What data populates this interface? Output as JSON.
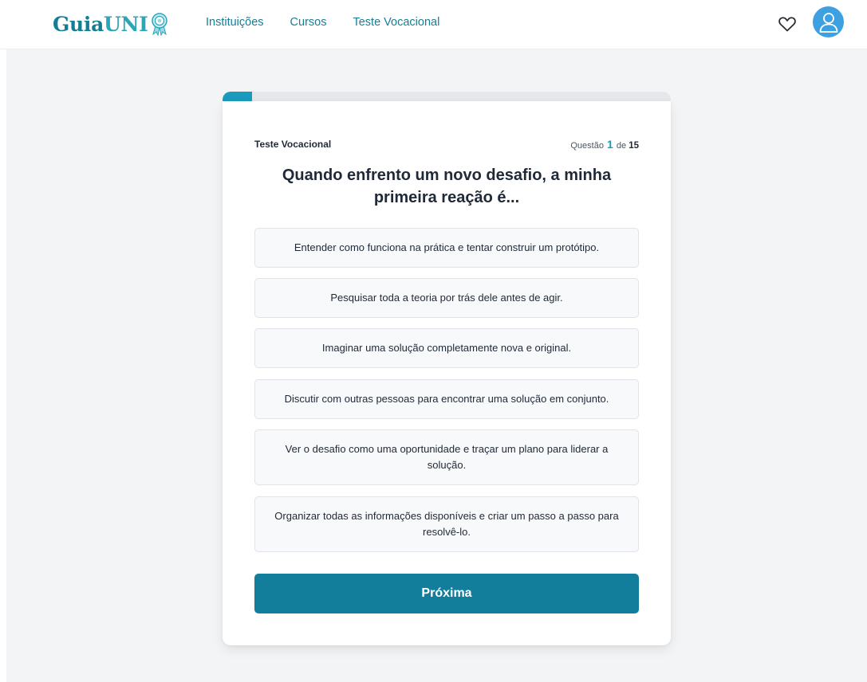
{
  "header": {
    "logo": {
      "part1": "Guia",
      "part2": "UNI",
      "icon": "ribbon-badge-icon"
    },
    "nav": [
      {
        "label": "Instituições"
      },
      {
        "label": "Cursos"
      },
      {
        "label": "Teste Vocacional"
      }
    ],
    "favorites_icon": "heart-icon",
    "avatar_icon": "user-icon"
  },
  "quiz": {
    "label": "Teste Vocacional",
    "counter_prefix": "Questão",
    "current": "1",
    "counter_sep": "de",
    "total": "15",
    "progress_fraction": 0.0667,
    "question": "Quando enfrento um novo desafio, a minha primeira reação é...",
    "options": [
      {
        "text": "Entender como funciona na prática e tentar construir um protótipo."
      },
      {
        "text": "Pesquisar toda a teoria por trás dele antes de agir."
      },
      {
        "text": "Imaginar uma solução completamente nova e original."
      },
      {
        "text": "Discutir com outras pessoas para encontrar uma solução em conjunto."
      },
      {
        "text": "Ver o desafio como uma oportunidade e traçar um plano para liderar a solução."
      },
      {
        "text": "Organizar todas as informações disponíveis e criar um passo a passo para resolvê-lo."
      }
    ],
    "next_label": "Próxima"
  },
  "colors": {
    "accent": "#1a9bbd",
    "button": "#137e9c",
    "nav_link": "#167e96",
    "avatar": "#3da0e0"
  }
}
